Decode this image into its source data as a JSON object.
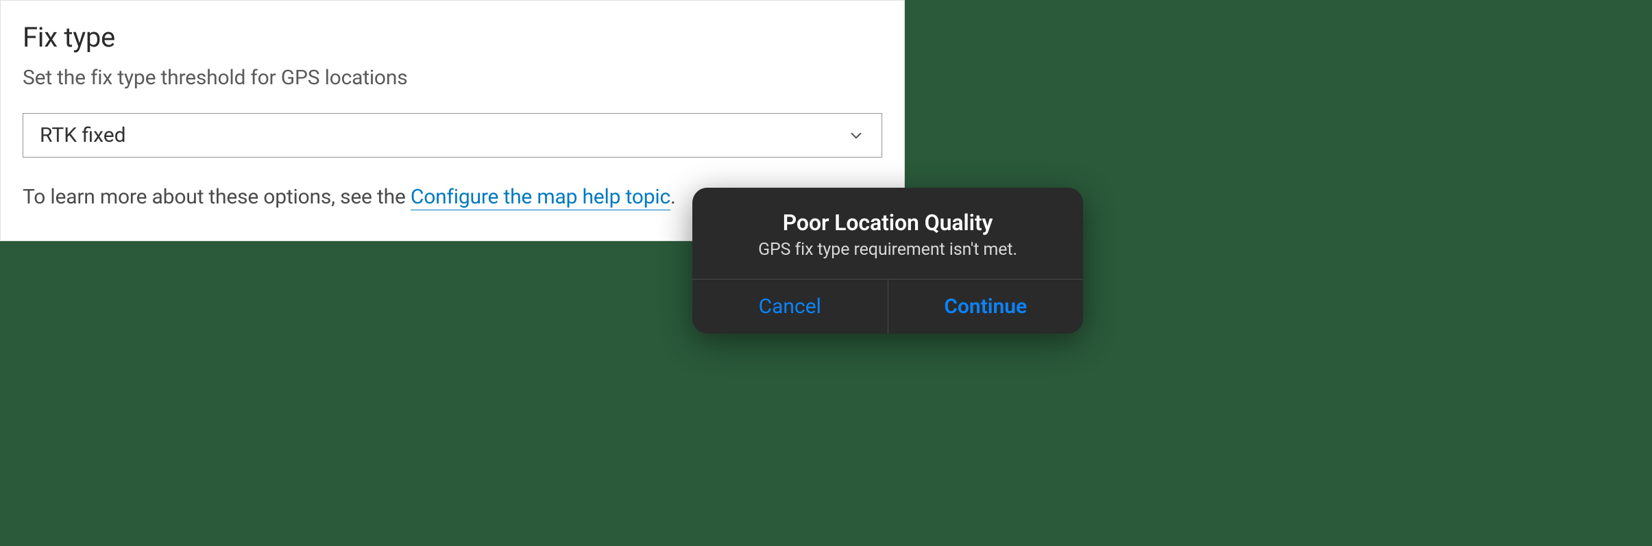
{
  "settings": {
    "title": "Fix type",
    "description": "Set the fix type threshold for GPS locations",
    "dropdown": {
      "selected": "RTK fixed"
    },
    "footer": {
      "prefix": "To learn more about these options, see the ",
      "link_text": "Configure the map help topic",
      "suffix": "."
    }
  },
  "alert": {
    "title": "Poor Location Quality",
    "message": "GPS fix type requirement isn't met.",
    "cancel_label": "Cancel",
    "continue_label": "Continue"
  }
}
